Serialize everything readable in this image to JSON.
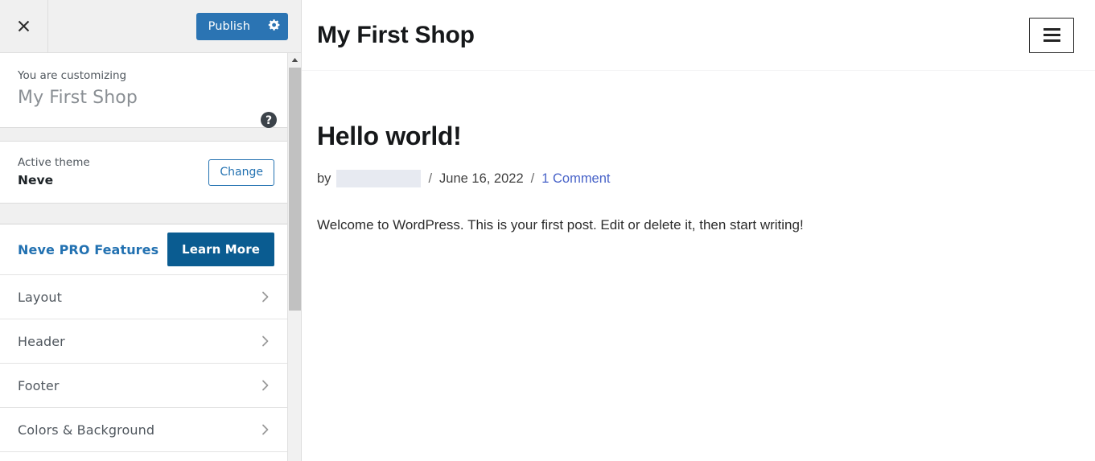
{
  "customizer": {
    "close_icon": "close-x-icon",
    "publish": {
      "label": "Publish",
      "gear_icon": "gear-icon",
      "color": "#2b74b3"
    },
    "info": {
      "subtitle": "You are customizing",
      "title": "My First Shop",
      "help_icon": "help-circle-icon"
    },
    "theme": {
      "label": "Active theme",
      "name": "Neve",
      "change_label": "Change",
      "accent": "#2271b1"
    },
    "pro": {
      "link_label": "Neve PRO Features",
      "button_label": "Learn More",
      "button_color": "#0a5c91"
    },
    "nav_items": [
      {
        "label": "Layout",
        "chevron": "chevron-right-icon"
      },
      {
        "label": "Header",
        "chevron": "chevron-right-icon"
      },
      {
        "label": "Footer",
        "chevron": "chevron-right-icon"
      },
      {
        "label": "Colors & Background",
        "chevron": "chevron-right-icon"
      }
    ],
    "scrollbar": {
      "up_arrow_icon": "scroll-up-arrow-icon",
      "thumb_color": "#c1c1c1"
    }
  },
  "preview": {
    "site_title": "My First Shop",
    "menu_toggle_icon": "hamburger-menu-icon",
    "post": {
      "title": "Hello world!",
      "meta": {
        "by_label": "by",
        "author": "",
        "separator": "/",
        "date": "June 16, 2022",
        "comments": "1 Comment",
        "comments_color": "#4762c8"
      },
      "body": "Welcome to WordPress. This is your first post. Edit or delete it, then start writing!"
    }
  }
}
